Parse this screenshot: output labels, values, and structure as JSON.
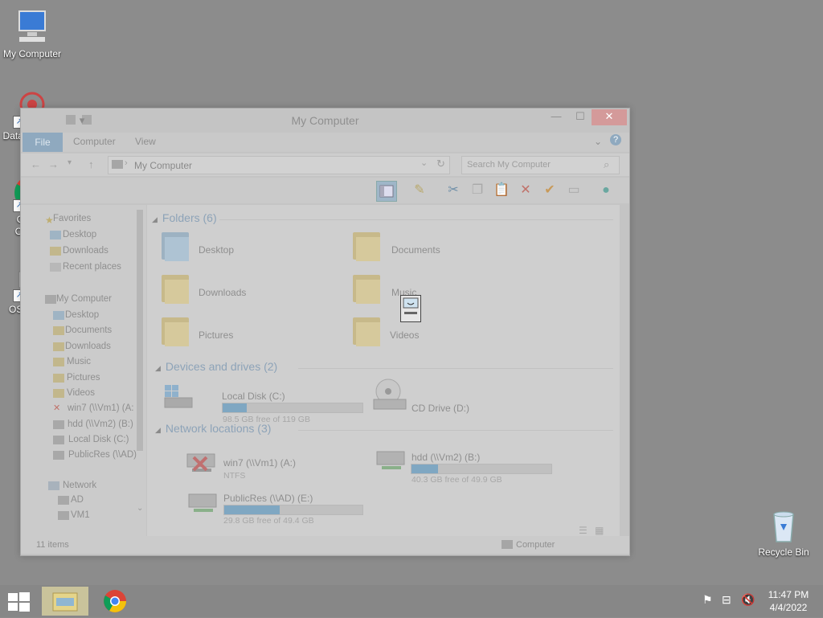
{
  "desktop": {
    "icons": [
      {
        "label": "My Computer"
      },
      {
        "label": "DataWagon..."
      },
      {
        "label": "Google Chrome"
      },
      {
        "label": "OSFMount"
      },
      {
        "label": "Recycle Bin"
      }
    ]
  },
  "window": {
    "title": "My Computer",
    "tabs": {
      "file": "File",
      "computer": "Computer",
      "view": "View"
    },
    "address": "My Computer",
    "search_placeholder": "Search My Computer",
    "nav": {
      "favorites": "Favorites",
      "fav_items": [
        "Desktop",
        "Downloads",
        "Recent places"
      ],
      "computer": "My Computer",
      "computer_items": [
        "Desktop",
        "Documents",
        "Downloads",
        "Music",
        "Pictures",
        "Videos",
        "win7 (\\\\Vm1) (A:",
        "hdd (\\\\Vm2) (B:)",
        "Local Disk (C:)",
        "PublicRes (\\\\AD)"
      ],
      "network": "Network",
      "network_items": [
        "AD",
        "VM1"
      ]
    },
    "groups": {
      "folders": "Folders (6)",
      "devices": "Devices and drives (2)",
      "network": "Network locations (3)"
    },
    "folders": [
      "Desktop",
      "Documents",
      "Downloads",
      "Music",
      "Pictures",
      "Videos"
    ],
    "drives": [
      {
        "name": "Local Disk (C:)",
        "info": "98.5 GB free of 119 GB",
        "used_fraction": 0.17
      },
      {
        "name": "CD Drive (D:)"
      }
    ],
    "netlocs": [
      {
        "name": "win7 (\\\\Vm1) (A:)",
        "info": "NTFS"
      },
      {
        "name": "hdd (\\\\Vm2) (B:)",
        "info": "40.3 GB free of 49.9 GB",
        "used_fraction": 0.19
      },
      {
        "name": "PublicRes (\\\\AD) (E:)",
        "info": "29.8 GB free of 49.4 GB",
        "used_fraction": 0.4
      }
    ],
    "status": {
      "items": "11 items",
      "location": "Computer"
    }
  },
  "taskbar": {
    "time": "11:47 PM",
    "date": "4/4/2022"
  },
  "colors": {
    "desktop": "#8c8c8c",
    "accent": "#7fa7c2"
  }
}
